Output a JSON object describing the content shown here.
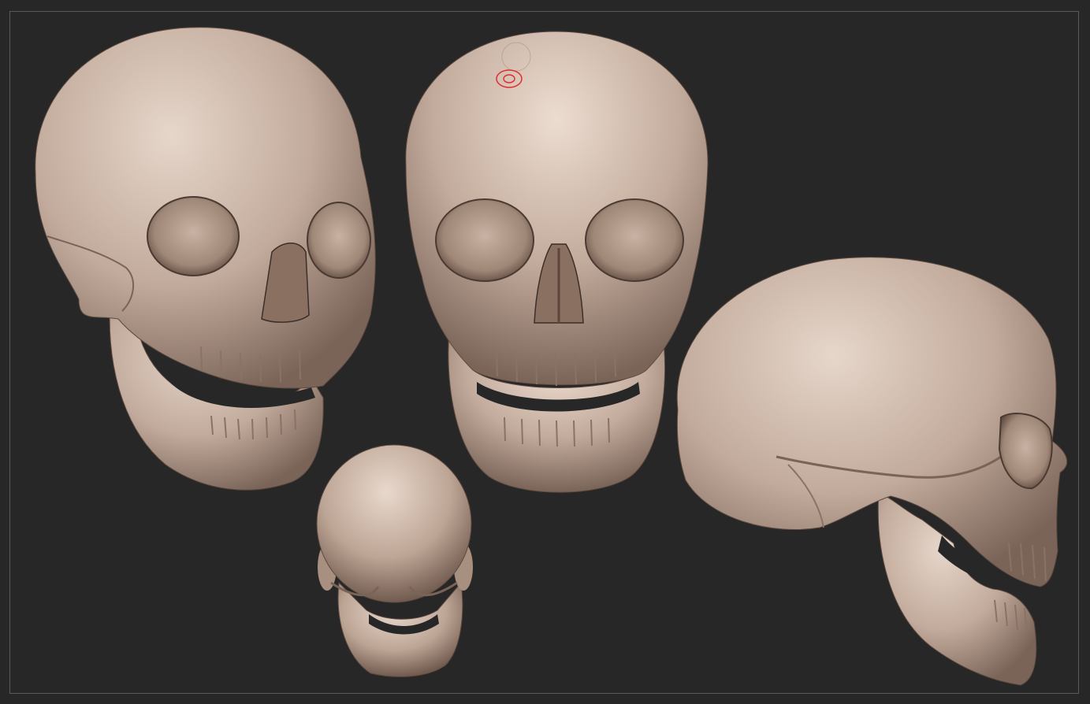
{
  "canvas": {
    "background_color": "#272727",
    "frame_color": "#5a5a5a"
  },
  "model": {
    "surface_color": "#c2ab9c",
    "highlight_color": "#e6d6ca",
    "shadow_color": "#7a6458",
    "views": [
      {
        "id": "three-quarter",
        "label": ""
      },
      {
        "id": "front",
        "label": ""
      },
      {
        "id": "top",
        "label": ""
      },
      {
        "id": "side",
        "label": ""
      }
    ]
  },
  "brush_cursor": {
    "color": "#e03030",
    "icon": "brush-cursor-icon"
  }
}
